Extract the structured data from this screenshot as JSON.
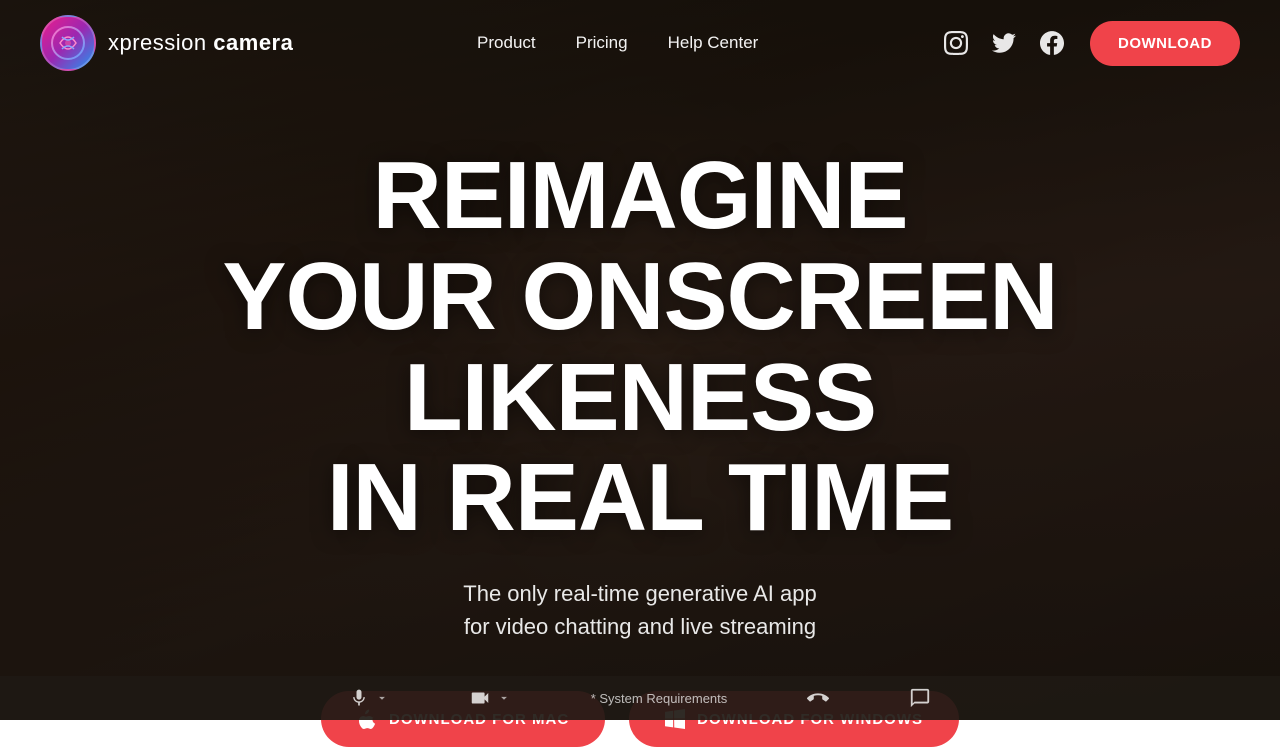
{
  "brand": {
    "logo_text_regular": "xpression",
    "logo_text_bold": "camera"
  },
  "nav": {
    "links": [
      {
        "label": "Product",
        "id": "product"
      },
      {
        "label": "Pricing",
        "id": "pricing"
      },
      {
        "label": "Help Center",
        "id": "help-center"
      }
    ],
    "download_label": "DOWNLOAD"
  },
  "social": {
    "instagram_label": "Instagram",
    "twitter_label": "Twitter",
    "facebook_label": "Facebook"
  },
  "hero": {
    "title_line1": "REIMAGINE",
    "title_line2": "YOUR ONSCREEN LIKENESS",
    "title_line3": "IN REAL TIME",
    "subtitle_line1": "The only real-time generative AI app",
    "subtitle_line2": "for video chatting and live streaming",
    "download_mac_label": "DOWNLOAD FOR MAC",
    "download_windows_label": "DOWNLOAD FOR WINDOWS"
  },
  "bottom_bar": {
    "system_req": "* System Requirements"
  }
}
